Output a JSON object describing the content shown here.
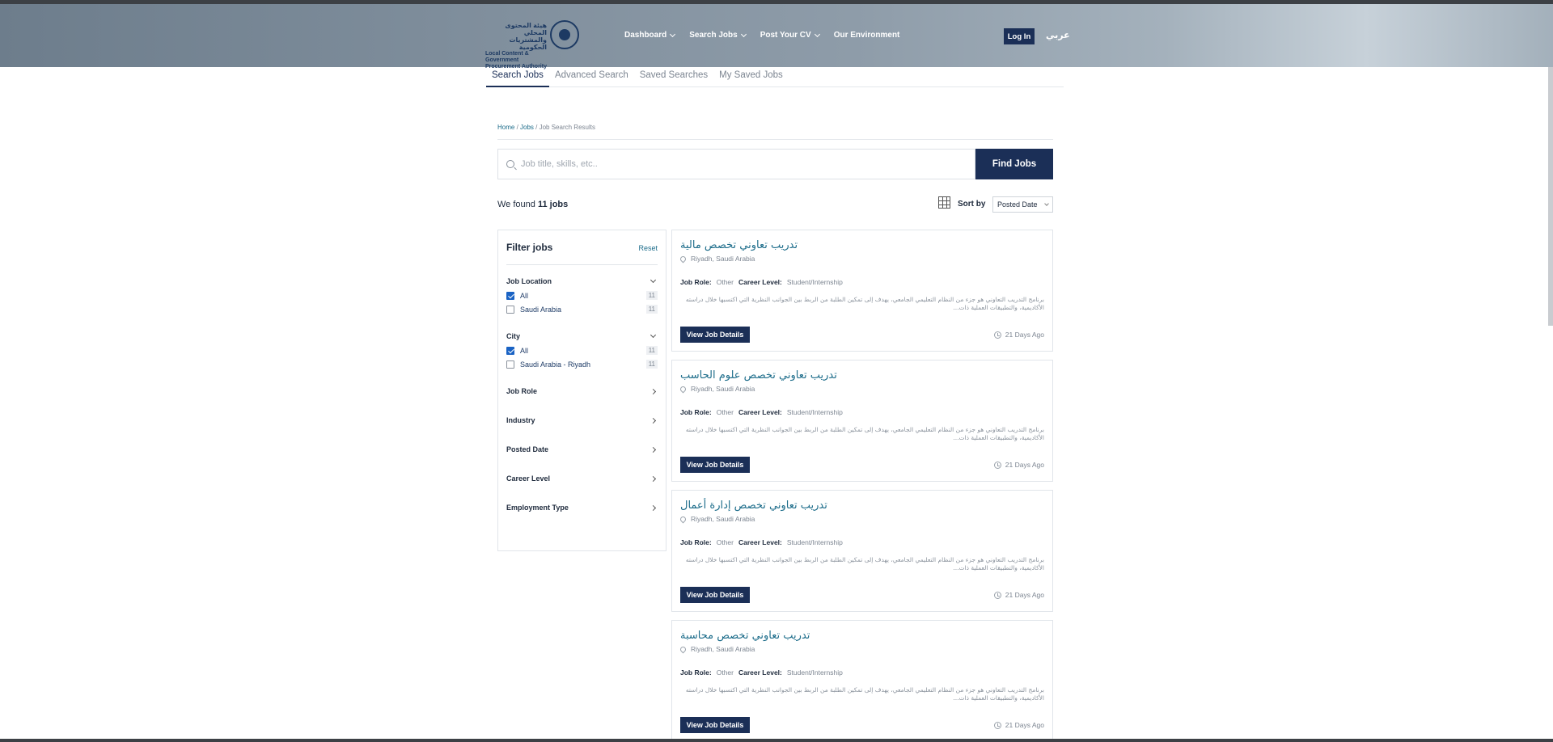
{
  "header": {
    "logo_ar": "هيئة المحتوى المحلي والمشتريات الحكومية",
    "logo_en": "Local Content & Government Procurement Authority",
    "nav": [
      {
        "label": "Dashboard"
      },
      {
        "label": "Search Jobs"
      },
      {
        "label": "Post Your CV"
      },
      {
        "label": "Our Environment"
      }
    ],
    "login_label": "Log In",
    "lang_label": "عربي"
  },
  "tabs": [
    {
      "label": "Search Jobs"
    },
    {
      "label": "Advanced Search"
    },
    {
      "label": "Saved Searches"
    },
    {
      "label": "My Saved Jobs"
    }
  ],
  "breadcrumb": {
    "home": "Home",
    "jobs": "Jobs",
    "current": "Job Search Results",
    "sep": " / "
  },
  "search": {
    "placeholder": "Job title, skills, etc..",
    "button": "Find Jobs"
  },
  "results": {
    "prefix": "We found",
    "count": "11 jobs",
    "sort_label": "Sort by",
    "sort_value": "Posted Date"
  },
  "filters": {
    "title": "Filter jobs",
    "reset": "Reset",
    "location": {
      "title": "Job Location",
      "options": [
        {
          "label": "All",
          "count": "11"
        },
        {
          "label": "Saudi Arabia",
          "count": "11"
        }
      ]
    },
    "city": {
      "title": "City",
      "options": [
        {
          "label": "All",
          "count": "11"
        },
        {
          "label": "Saudi Arabia - Riyadh",
          "count": "11"
        }
      ]
    },
    "collapsed": [
      {
        "label": "Job Role"
      },
      {
        "label": "Industry"
      },
      {
        "label": "Posted Date"
      },
      {
        "label": "Career Level"
      },
      {
        "label": "Employment Type"
      }
    ]
  },
  "job_labels": {
    "role": "Job Role:",
    "level": "Career Level:",
    "view": "View Job Details"
  },
  "jobs": [
    {
      "title": "تدريب تعاوني تخصص مالية",
      "location": "Riyadh, Saudi Arabia",
      "role": "Other",
      "level": "Student/Internship",
      "description": "برنامج التدريب التعاوني هو جزء من النظام التعليمي الجامعي، يهدف إلى تمكين الطلبة من الربط بين الجوانب النظرية التي اكتسبها خلال دراسته الأكاديمية، والتطبيقات العملية ذات...",
      "age": "21 Days Ago"
    },
    {
      "title": "تدريب تعاوني تخصص علوم الحاسب",
      "location": "Riyadh, Saudi Arabia",
      "role": "Other",
      "level": "Student/Internship",
      "description": "برنامج التدريب التعاوني هو جزء من النظام التعليمي الجامعي، يهدف إلى تمكين الطلبة من الربط بين الجوانب النظرية التي اكتسبها خلال دراسته الأكاديمية، والتطبيقات العملية ذات...",
      "age": "21 Days Ago"
    },
    {
      "title": "تدريب تعاوني تخصص إدارة أعمال",
      "location": "Riyadh, Saudi Arabia",
      "role": "Other",
      "level": "Student/Internship",
      "description": "برنامج التدريب التعاوني هو جزء من النظام التعليمي الجامعي، يهدف إلى تمكين الطلبة من الربط بين الجوانب النظرية التي اكتسبها خلال دراسته الأكاديمية، والتطبيقات العملية ذات...",
      "age": "21 Days Ago"
    },
    {
      "title": "تدريب تعاوني تخصص محاسبة",
      "location": "Riyadh, Saudi Arabia",
      "role": "Other",
      "level": "Student/Internship",
      "description": "برنامج التدريب التعاوني هو جزء من النظام التعليمي الجامعي، يهدف إلى تمكين الطلبة من الربط بين الجوانب النظرية التي اكتسبها خلال دراسته الأكاديمية، والتطبيقات العملية ذات...",
      "age": "21 Days Ago"
    }
  ],
  "colors": {
    "primary": "#1b2f57",
    "link": "#1c6c8a",
    "checkbox": "#1a63c4"
  }
}
